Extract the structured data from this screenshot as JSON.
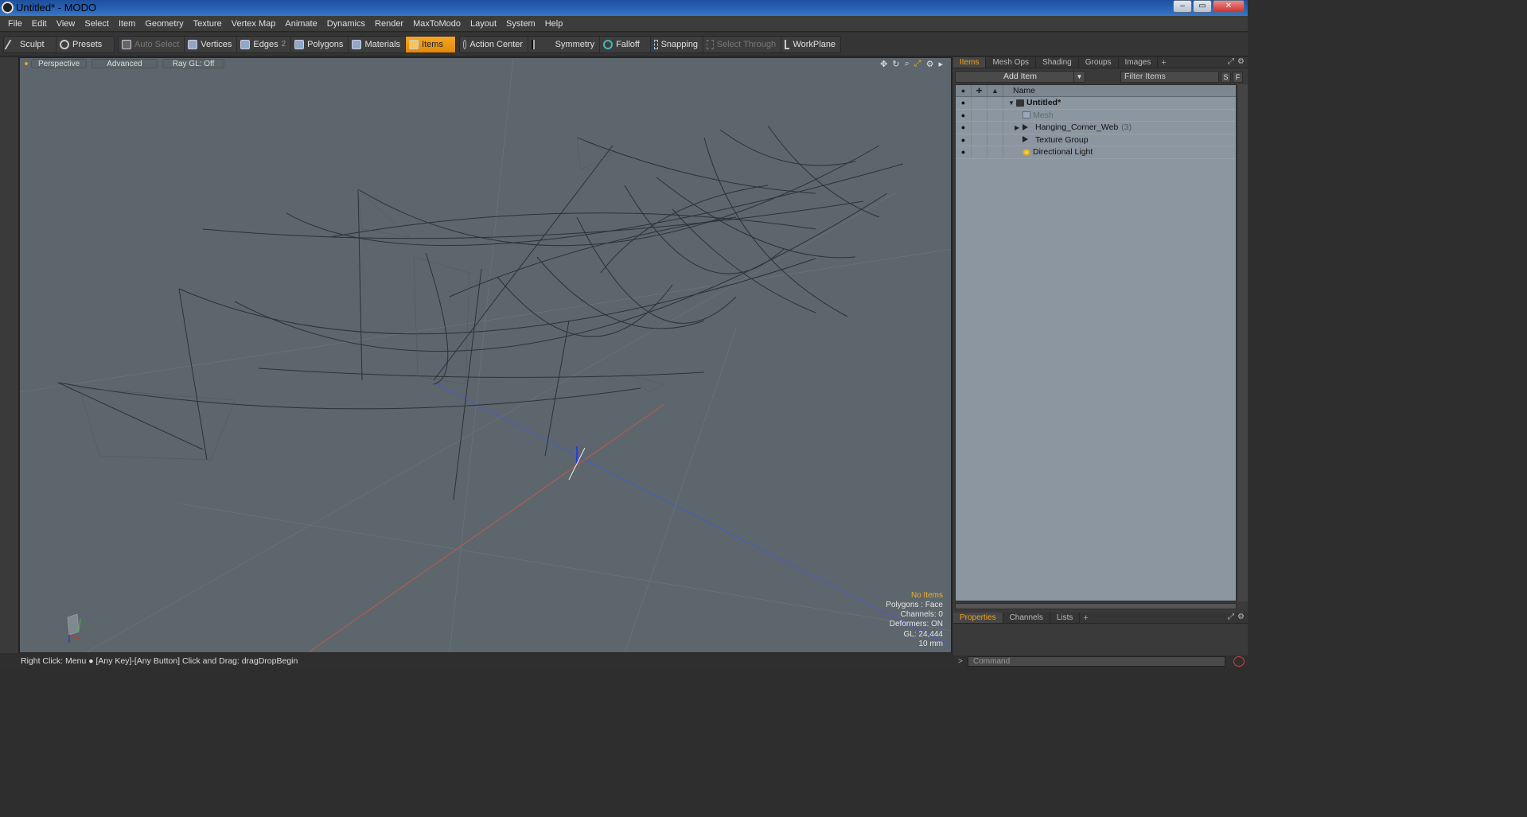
{
  "window": {
    "title": "Untitled* - MODO",
    "buttons": [
      "–",
      "▭",
      "✕"
    ]
  },
  "menubar": [
    "File",
    "Edit",
    "View",
    "Select",
    "Item",
    "Geometry",
    "Texture",
    "Vertex Map",
    "Animate",
    "Dynamics",
    "Render",
    "MaxToModo",
    "Layout",
    "System",
    "Help"
  ],
  "toolbar": {
    "sculpt": "Sculpt",
    "presets": "Presets",
    "auto_select": "Auto Select",
    "vertices": "Vertices",
    "edges": "Edges",
    "edges_count": "2",
    "polygons": "Polygons",
    "materials": "Materials",
    "items": "Items",
    "action_center": "Action Center",
    "symmetry": "Symmetry",
    "falloff": "Falloff",
    "snapping": "Snapping",
    "select_through": "Select Through",
    "workplane": "WorkPlane"
  },
  "viewport": {
    "view_mode": "Perspective",
    "shading": "Advanced",
    "raygl": "Ray GL: Off",
    "info": {
      "selection": "No Items",
      "polygons": "Polygons : Face",
      "channels": "Channels: 0",
      "deformers": "Deformers: ON",
      "gl": "GL: 24,444",
      "scale": "10 mm"
    }
  },
  "items_panel": {
    "tabs": [
      "Items",
      "Mesh Ops",
      "Shading",
      "Groups",
      "Images"
    ],
    "add_item": "Add Item",
    "filter_placeholder": "Filter Items",
    "s_btn": "S",
    "f_btn": "F",
    "name_header": "Name",
    "rows": [
      {
        "name": "Untitled*",
        "icon": "scene-icon",
        "count": ""
      },
      {
        "name": "Mesh",
        "icon": "mesh-icon",
        "count": ""
      },
      {
        "name": "Hanging_Corner_Web",
        "icon": "group-icon",
        "count": "(3)"
      },
      {
        "name": "Texture Group",
        "icon": "group-icon",
        "count": ""
      },
      {
        "name": "Directional Light",
        "icon": "light-icon",
        "count": ""
      }
    ]
  },
  "props_panel": {
    "tabs": [
      "Properties",
      "Channels",
      "Lists"
    ]
  },
  "statusbar": {
    "text": "Right Click: Menu ● [Any Key]-[Any Button] Click and Drag: dragDropBegin"
  },
  "command": {
    "prompt": ">",
    "placeholder": "Command"
  },
  "colors": {
    "accent": "#f0a020",
    "viewport_bg": "#5c666c",
    "list_bg": "#8c96a0"
  }
}
